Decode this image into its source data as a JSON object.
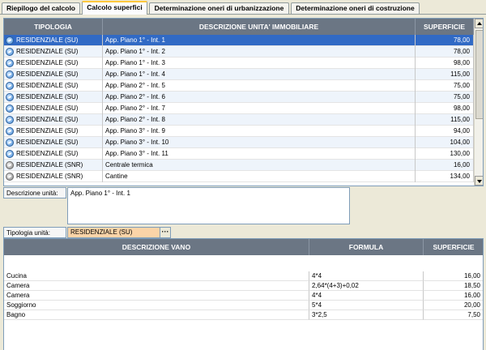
{
  "tabs": [
    {
      "label": "Riepilogo del calcolo",
      "active": false
    },
    {
      "label": "Calcolo superfici",
      "active": true
    },
    {
      "label": "Determinazione oneri di urbanizzazione",
      "active": false
    },
    {
      "label": "Determinazione oneri di costruzione",
      "active": false
    }
  ],
  "units_table": {
    "headers": {
      "tipologia": "TIPOLOGIA",
      "descrizione": "DESCRIZIONE UNITA' IMMOBILIARE",
      "superficie": "SUPERFICIE"
    },
    "rows": [
      {
        "icon": "residential-su-icon",
        "tipologia": "RESIDENZIALE (SU)",
        "descrizione": "App. Piano 1° - Int. 1",
        "superficie": "78,00",
        "selected": true
      },
      {
        "icon": "residential-su-icon",
        "tipologia": "RESIDENZIALE (SU)",
        "descrizione": "App. Piano 1° - Int. 2",
        "superficie": "78,00",
        "selected": false
      },
      {
        "icon": "residential-su-icon",
        "tipologia": "RESIDENZIALE (SU)",
        "descrizione": "App. Piano 1° - Int. 3",
        "superficie": "98,00",
        "selected": false
      },
      {
        "icon": "residential-su-icon",
        "tipologia": "RESIDENZIALE (SU)",
        "descrizione": "App. Piano 1° - Int. 4",
        "superficie": "115,00",
        "selected": false
      },
      {
        "icon": "residential-su-icon",
        "tipologia": "RESIDENZIALE (SU)",
        "descrizione": "App. Piano 2° - Int. 5",
        "superficie": "75,00",
        "selected": false
      },
      {
        "icon": "residential-su-icon",
        "tipologia": "RESIDENZIALE (SU)",
        "descrizione": "App. Piano 2° - Int. 6",
        "superficie": "75,00",
        "selected": false
      },
      {
        "icon": "residential-su-icon",
        "tipologia": "RESIDENZIALE (SU)",
        "descrizione": "App. Piano 2° - Int. 7",
        "superficie": "98,00",
        "selected": false
      },
      {
        "icon": "residential-su-icon",
        "tipologia": "RESIDENZIALE (SU)",
        "descrizione": "App. Piano 2° - Int. 8",
        "superficie": "115,00",
        "selected": false
      },
      {
        "icon": "residential-su-icon",
        "tipologia": "RESIDENZIALE (SU)",
        "descrizione": "App. Piano 3° - Int. 9",
        "superficie": "94,00",
        "selected": false
      },
      {
        "icon": "residential-su-icon",
        "tipologia": "RESIDENZIALE (SU)",
        "descrizione": "App. Piano 3° - Int. 10",
        "superficie": "104,00",
        "selected": false
      },
      {
        "icon": "residential-su-icon",
        "tipologia": "RESIDENZIALE (SU)",
        "descrizione": "App. Piano 3° - Int. 11",
        "superficie": "130,00",
        "selected": false
      },
      {
        "icon": "residential-snr-icon",
        "tipologia": "RESIDENZIALE (SNR)",
        "descrizione": "Centrale termica",
        "superficie": "16,00",
        "selected": false
      },
      {
        "icon": "residential-snr-icon",
        "tipologia": "RESIDENZIALE (SNR)",
        "descrizione": "Cantine",
        "superficie": "134,00",
        "selected": false
      }
    ]
  },
  "unit_description": {
    "label": "Descrizione unità:",
    "value": "App. Piano 1° - Int. 1"
  },
  "unit_type": {
    "label": "Tipologia unità:",
    "value": "RESIDENZIALE (SU)",
    "button": "···"
  },
  "rooms_table": {
    "headers": {
      "descrizione": "DESCRIZIONE VANO",
      "formula": "FORMULA",
      "superficie": "SUPERFICIE"
    },
    "rows": [
      {
        "descrizione": "Cucina",
        "formula": "4*4",
        "superficie": "16,00"
      },
      {
        "descrizione": "Camera",
        "formula": "2,64*(4+3)+0,02",
        "superficie": "18,50"
      },
      {
        "descrizione": "Camera",
        "formula": "4*4",
        "superficie": "16,00"
      },
      {
        "descrizione": "Soggiorno",
        "formula": "5*4",
        "superficie": "20,00"
      },
      {
        "descrizione": "Bagno",
        "formula": "3*2,5",
        "superficie": "7,50"
      }
    ]
  },
  "colors": {
    "selection": "#316ac5",
    "header": "#6b7684",
    "tab_accent": "#ffc83c",
    "type_field": "#fbd4a8"
  }
}
